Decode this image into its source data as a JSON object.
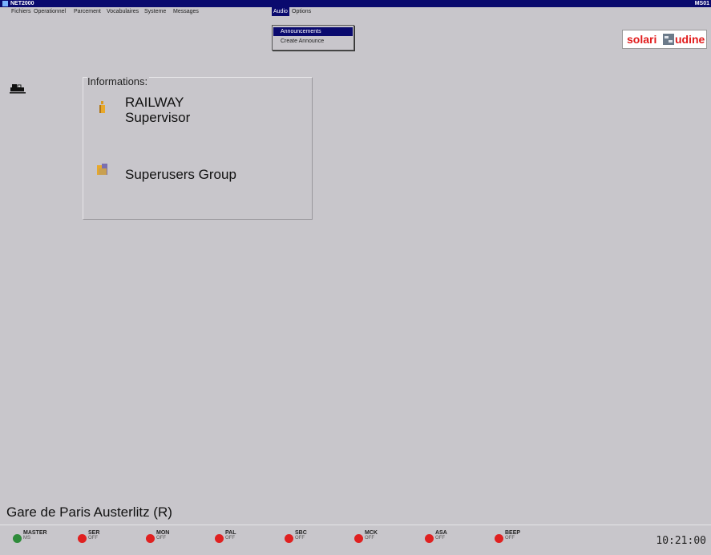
{
  "window": {
    "title": "NET2000",
    "corner": "MS01"
  },
  "menu": [
    {
      "label": "Fichiers"
    },
    {
      "label": "Operationnel"
    },
    {
      "label": "Parcement"
    },
    {
      "label": "Vocabulaires"
    },
    {
      "label": "Systeme"
    },
    {
      "label": "Messages"
    },
    {
      "label": "Audio",
      "active": true
    },
    {
      "label": "Options"
    }
  ],
  "dropdown": {
    "items": [
      {
        "label": "Announcements",
        "selected": true
      },
      {
        "label": "Create Announce"
      }
    ]
  },
  "logo": {
    "text_left": "solari",
    "text_right": "udine"
  },
  "info": {
    "header": "Informations:",
    "name_line1": "RAILWAY",
    "name_line2": "Supervisor",
    "group": "Superusers Group"
  },
  "station": "Gare de Paris Austerlitz (R)",
  "status": [
    {
      "name": "MASTER",
      "state": "MS",
      "color": "#2e8b3a"
    },
    {
      "name": "SER",
      "state": "OFF",
      "color": "#e02020"
    },
    {
      "name": "MON",
      "state": "OFF",
      "color": "#e02020"
    },
    {
      "name": "PAL",
      "state": "OFF",
      "color": "#e02020"
    },
    {
      "name": "SBC",
      "state": "OFF",
      "color": "#e02020"
    },
    {
      "name": "MCK",
      "state": "OFF",
      "color": "#e02020"
    },
    {
      "name": "ASA",
      "state": "OFF",
      "color": "#e02020"
    },
    {
      "name": "BEEP",
      "state": "OFF",
      "color": "#e02020"
    }
  ],
  "clock": "10:21:00",
  "colors": {
    "titlebar": "#0a0a6e",
    "background": "#c8c6cb",
    "logo_red": "#e11b1b"
  }
}
